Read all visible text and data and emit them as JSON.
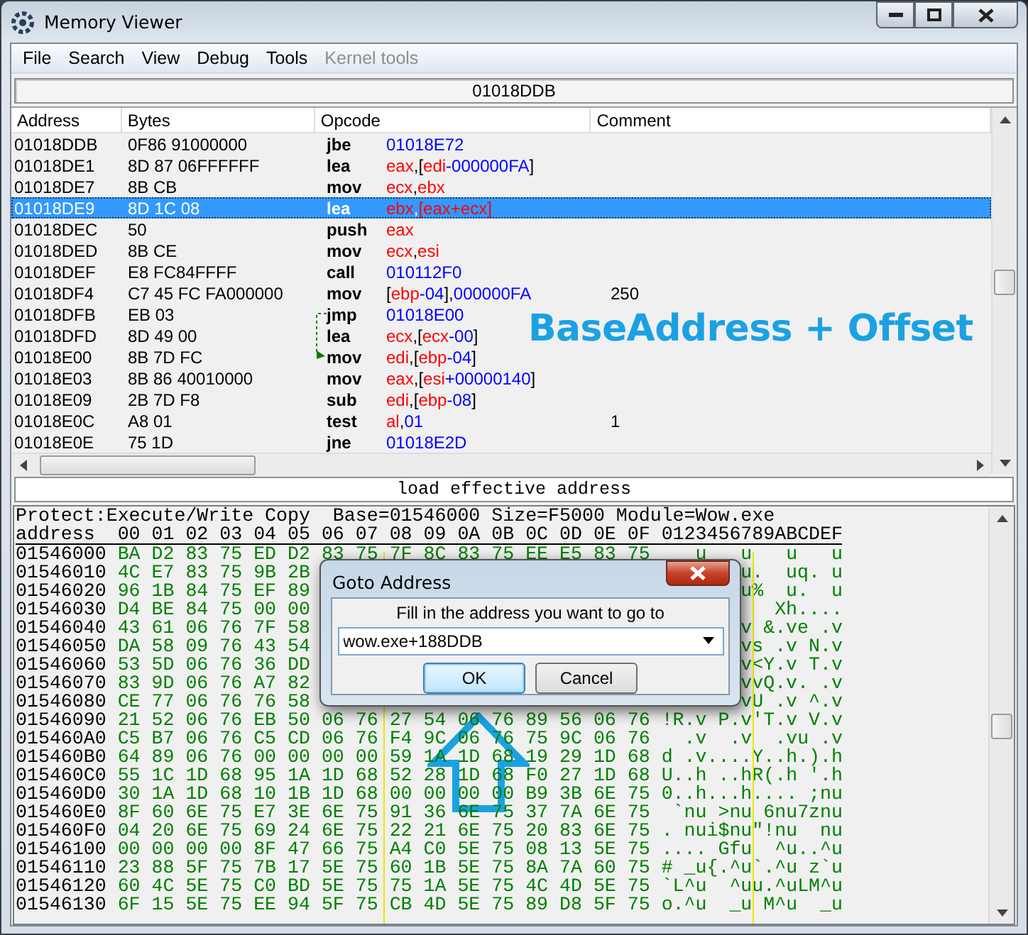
{
  "window": {
    "title": "Memory Viewer"
  },
  "menu": [
    {
      "label": "File",
      "disabled": false
    },
    {
      "label": "Search",
      "disabled": false
    },
    {
      "label": "View",
      "disabled": false
    },
    {
      "label": "Debug",
      "disabled": false
    },
    {
      "label": "Tools",
      "disabled": false
    },
    {
      "label": "Kernel tools",
      "disabled": true
    }
  ],
  "address_bar": "01018DDB",
  "columns": [
    "Address",
    "Bytes",
    "Opcode",
    "Comment"
  ],
  "rows": [
    {
      "address": "01018DDB",
      "bytes": "0F86 91000000",
      "opcode": "jbe",
      "operands": [
        {
          "text": "01018E72",
          "kind": "num"
        }
      ],
      "selected": false
    },
    {
      "address": "01018DE1",
      "bytes": "8D 87 06FFFFFF",
      "opcode": "lea",
      "operands": [
        {
          "text": "eax",
          "kind": "reg"
        },
        {
          "text": ",[",
          "kind": "plain"
        },
        {
          "text": "edi",
          "kind": "reg"
        },
        {
          "text": "-000000FA",
          "kind": "num"
        },
        {
          "text": "]",
          "kind": "plain"
        }
      ],
      "selected": false
    },
    {
      "address": "01018DE7",
      "bytes": "8B CB",
      "opcode": "mov",
      "operands": [
        {
          "text": "ecx",
          "kind": "reg"
        },
        {
          "text": ",",
          "kind": "plain"
        },
        {
          "text": "ebx",
          "kind": "reg"
        }
      ],
      "selected": false
    },
    {
      "address": "01018DE9",
      "bytes": "8D 1C 08",
      "opcode": "lea",
      "operands": [
        {
          "text": "ebx",
          "kind": "reg"
        },
        {
          "text": ",",
          "kind": "plain"
        },
        {
          "text": "[eax+ecx]",
          "kind": "reg"
        }
      ],
      "selected": true
    },
    {
      "address": "01018DEC",
      "bytes": "50",
      "opcode": "push",
      "operands": [
        {
          "text": "eax",
          "kind": "reg"
        }
      ],
      "selected": false
    },
    {
      "address": "01018DED",
      "bytes": "8B CE",
      "opcode": "mov",
      "operands": [
        {
          "text": "ecx",
          "kind": "reg"
        },
        {
          "text": ",",
          "kind": "plain"
        },
        {
          "text": "esi",
          "kind": "reg"
        }
      ],
      "selected": false
    },
    {
      "address": "01018DEF",
      "bytes": "E8 FC84FFFF",
      "opcode": "call",
      "operands": [
        {
          "text": "010112F0",
          "kind": "num"
        }
      ],
      "selected": false
    },
    {
      "address": "01018DF4",
      "bytes": "C7 45 FC FA000000",
      "opcode": "mov",
      "operands": [
        {
          "text": "[",
          "kind": "plain"
        },
        {
          "text": "ebp",
          "kind": "reg"
        },
        {
          "text": "-04",
          "kind": "num"
        },
        {
          "text": "],",
          "kind": "plain"
        },
        {
          "text": "000000FA",
          "kind": "num"
        }
      ],
      "comment": "250",
      "selected": false
    },
    {
      "address": "01018DFB",
      "bytes": "EB 03",
      "opcode": "jmp",
      "operands": [
        {
          "text": "01018E00",
          "kind": "num"
        }
      ],
      "jump_from": true,
      "selected": false
    },
    {
      "address": "01018DFD",
      "bytes": "8D 49 00",
      "opcode": "lea",
      "operands": [
        {
          "text": "ecx",
          "kind": "reg"
        },
        {
          "text": ",[",
          "kind": "plain"
        },
        {
          "text": "ecx",
          "kind": "reg"
        },
        {
          "text": "-00",
          "kind": "num"
        },
        {
          "text": "]",
          "kind": "plain"
        }
      ],
      "selected": false
    },
    {
      "address": "01018E00",
      "bytes": "8B 7D FC",
      "opcode": "mov",
      "operands": [
        {
          "text": "edi",
          "kind": "reg"
        },
        {
          "text": ",[",
          "kind": "plain"
        },
        {
          "text": "ebp",
          "kind": "reg"
        },
        {
          "text": "-04",
          "kind": "num"
        },
        {
          "text": "]",
          "kind": "plain"
        }
      ],
      "jump_to": true,
      "selected": false
    },
    {
      "address": "01018E03",
      "bytes": "8B 86 40010000",
      "opcode": "mov",
      "operands": [
        {
          "text": "eax",
          "kind": "reg"
        },
        {
          "text": ",[",
          "kind": "plain"
        },
        {
          "text": "esi",
          "kind": "reg"
        },
        {
          "text": "+00000140",
          "kind": "num"
        },
        {
          "text": "]",
          "kind": "plain"
        }
      ],
      "selected": false
    },
    {
      "address": "01018E09",
      "bytes": "2B 7D F8",
      "opcode": "sub",
      "operands": [
        {
          "text": "edi",
          "kind": "reg"
        },
        {
          "text": ",[",
          "kind": "plain"
        },
        {
          "text": "ebp",
          "kind": "reg"
        },
        {
          "text": "-08",
          "kind": "num"
        },
        {
          "text": "]",
          "kind": "plain"
        }
      ],
      "selected": false
    },
    {
      "address": "01018E0C",
      "bytes": "A8 01",
      "opcode": "test",
      "operands": [
        {
          "text": "al",
          "kind": "reg"
        },
        {
          "text": ",",
          "kind": "plain"
        },
        {
          "text": "01",
          "kind": "num"
        }
      ],
      "comment": "1",
      "selected": false
    },
    {
      "address": "01018E0E",
      "bytes": "75 1D",
      "opcode": "jne",
      "operands": [
        {
          "text": "01018E2D",
          "kind": "num"
        }
      ],
      "selected": false
    }
  ],
  "status_text": "load effective address",
  "annotation": "BaseAddress + Offset",
  "hex": {
    "info": "Protect:Execute/Write Copy  Base=01546000 Size=F5000 Module=Wow.exe",
    "header": "address  00 01 02 03 04 05 06 07 08 09 0A 0B 0C 0D 0E 0F 0123456789ABCDEF",
    "rows": [
      {
        "address": "01546000",
        "bytes": "BA D2 83 75 ED D2 83 75 7F 8C 83 75 EE E5 83 75",
        "ascii": "   u   u   u   u"
      },
      {
        "address": "01546010",
        "bytes": "4C E7 83 75 9B 2B",
        "ascii": "u.  uq. u"
      },
      {
        "address": "01546020",
        "bytes": "96 1B 84 75 EF 89",
        "ascii": "u%  u.  u"
      },
      {
        "address": "01546030",
        "bytes": "D4 BE 84 75 00 00",
        "ascii": "Xh...."
      },
      {
        "address": "01546040",
        "bytes": "43 61 06 76 7F 58",
        "ascii": "v &.ve .v"
      },
      {
        "address": "01546050",
        "bytes": "DA 58 09 76 43 54",
        "ascii": "vs .v N.v"
      },
      {
        "address": "01546060",
        "bytes": "53 5D 06 76 36 DD",
        "ascii": "v<Y.v T.v"
      },
      {
        "address": "01546070",
        "bytes": "83 9D 06 76 A7 82",
        "ascii": "vvQ.v. .v"
      },
      {
        "address": "01546080",
        "bytes": "CE 77 06 76 76 58",
        "ascii": "vU .v ^.v"
      },
      {
        "address": "01546090",
        "bytes": "21 52 06 76 EB 50 06 76 27 54 06 76 89 56 06 76",
        "ascii": "!R.v P.v'T.v V.v"
      },
      {
        "address": "015460A0",
        "bytes": "C5 B7 06 76 C5 CD 06 76 F4 9C 06 76 75 9C 06 76",
        "ascii": "  .v  .v  .vu .v"
      },
      {
        "address": "015460B0",
        "bytes": "64 89 06 76 00 00 00 00 59 1A 1D 68 19 29 1D 68",
        "ascii": "d .v....Y..h.).h"
      },
      {
        "address": "015460C0",
        "bytes": "55 1C 1D 68 95 1A 1D 68 52 28 1D 68 F0 27 1D 68",
        "ascii": "U..h ..hR(.h '.h"
      },
      {
        "address": "015460D0",
        "bytes": "30 1A 1D 68 10 1B 1D 68 00 00 00 00 B9 3B 6E 75",
        "ascii": "0..h...h.... ;nu"
      },
      {
        "address": "015460E0",
        "bytes": "8F 60 6E 75 E7 3E 6E 75 91 36 6E 75 37 7A 6E 75",
        "ascii": " `nu >nu 6nu7znu"
      },
      {
        "address": "015460F0",
        "bytes": "04 20 6E 75 69 24 6E 75 22 21 6E 75 20 83 6E 75",
        "ascii": ". nui$nu\"!nu  nu"
      },
      {
        "address": "01546100",
        "bytes": "00 00 00 00 8F 47 66 75 A4 C0 5E 75 08 13 5E 75",
        "ascii": ".... Gfu  ^u..^u"
      },
      {
        "address": "01546110",
        "bytes": "23 88 5F 75 7B 17 5E 75 60 1B 5E 75 8A 7A 60 75",
        "ascii": "# _u{.^u`.^u z`u"
      },
      {
        "address": "01546120",
        "bytes": "60 4C 5E 75 C0 BD 5E 75 75 1A 5E 75 4C 4D 5E 75",
        "ascii": "`L^u  ^uu.^uLM^u"
      },
      {
        "address": "01546130",
        "bytes": "6F 15 5E 75 EE 94 5F 75 CB 4D 5E 75 89 D8 5F 75",
        "ascii": "o.^u  _u M^u  _u"
      }
    ]
  },
  "dialog": {
    "title": "Goto Address",
    "prompt": "Fill in the address you want to go to",
    "value": "wow.exe+188DDB",
    "buttons": [
      {
        "label": "OK",
        "selected": true
      },
      {
        "label": "Cancel",
        "selected": false
      }
    ]
  }
}
